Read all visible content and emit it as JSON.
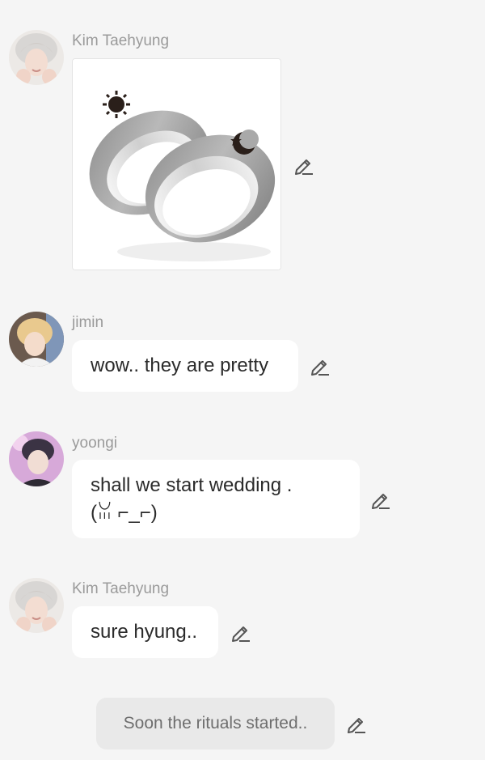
{
  "messages": [
    {
      "sender": "Kim Taehyung",
      "type": "image",
      "image_alt": "silver ring pair with sun and moon engravings",
      "avatar_icon": "avatar-taehyung"
    },
    {
      "sender": "jimin",
      "type": "text",
      "text": "wow..  they are pretty",
      "avatar_icon": "avatar-jimin"
    },
    {
      "sender": "yoongi",
      "type": "text",
      "text": "shall we start wedding .\n(ꈍ ⌐_⌐)",
      "avatar_icon": "avatar-yoongi"
    },
    {
      "sender": "Kim Taehyung",
      "type": "text",
      "text": "sure hyung..",
      "avatar_icon": "avatar-taehyung"
    }
  ],
  "system_message": {
    "text": "Soon the rituals started.."
  },
  "icons": {
    "edit": "pencil-edit-icon"
  },
  "colors": {
    "background": "#f5f5f5",
    "bubble": "#ffffff",
    "system_bubble": "#e9e9e9",
    "sender_text": "#9a9a9a",
    "edit_icon": "#555555"
  }
}
